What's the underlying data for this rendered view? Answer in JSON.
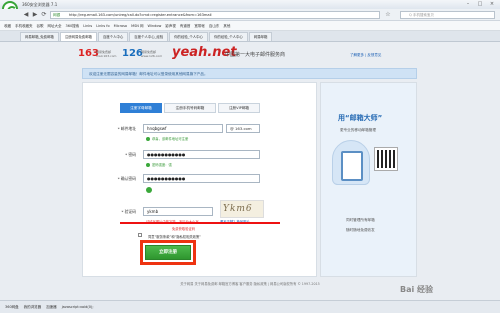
{
  "window": {
    "title": "360安全浏览器 7.1"
  },
  "addressbar": {
    "url": "http://reg.email.163.com/unireg/call.do?cmd=register.entrance&from=163mail",
    "security_tag": "网银",
    "search_placeholder": "Q 手机搜索宝贝"
  },
  "bookmarks": [
    "收藏",
    "手机收藏夹",
    "谷歌",
    "网址大全",
    "360搜索",
    "Links",
    "Links fo",
    "Microso",
    "MSN 网",
    "Window",
    "影声视",
    "有道首",
    "宽带帐",
    "百山东",
    "其他"
  ],
  "tabs": [
    {
      "label": "网易邮箱_免费邮箱",
      "active": false
    },
    {
      "label": "注册网易免费邮箱",
      "active": true
    },
    {
      "label": "百度个人中心",
      "active": false
    },
    {
      "label": "百度个人中心_经验",
      "active": false
    },
    {
      "label": "你的经验_个人中心",
      "active": false
    },
    {
      "label": "你的经验_个人中心",
      "active": false
    },
    {
      "label": "网易邮箱",
      "active": false
    }
  ],
  "header": {
    "brand_163": "163",
    "brand_163_sub": "网易免费邮 mail.163.com",
    "brand_126": "126",
    "brand_126_sub": "网易免费邮 www.126.com",
    "brand_yeah": "yeah.net",
    "slogan": "中国第一大电子邮件服务商",
    "links": "了解更多 | 反馈意见"
  },
  "notice": "欢迎注册无限容量的网易邮箱！邮件地址可以登录使用其他网易旗下产品。",
  "reg_tabs": [
    {
      "label": "注册字母邮箱",
      "active": true
    },
    {
      "label": "注册手机号码邮箱",
      "active": false
    },
    {
      "label": "注册VIP邮箱",
      "active": false
    }
  ],
  "form": {
    "email_label": "* 邮件地址",
    "email_value": "hnqbgswf",
    "domain": "@ 163.com",
    "email_hint": "恭喜，该邮件地址可注册",
    "password_label": "* 密码",
    "password_value": "●●●●●●●●●●●",
    "password_hint": "密码强度：强",
    "confirm_label": "* 确认密码",
    "confirm_value": "●●●●●●●●●●●",
    "captcha_label": "* 验证码",
    "captcha_value": "ykmb",
    "captcha_image_text": "Ykm6",
    "captcha_hint": "请填写图片中的字符，不区分大小写",
    "captcha_refresh": "看不清楚？换张图片",
    "captcha_error": "免费获取验证码",
    "agree_text": "同意“服务条款”和“隐私权相关政策”",
    "submit_label": "立即注册"
  },
  "promo": {
    "title": "用“邮箱大师”",
    "subtitle": "更专业的移动邮箱管理",
    "feature1": "同时管理所有邮箱",
    "feature2": "随时随地免费收发"
  },
  "footer": "关于网易  关于网易免费邮  邮箱官方博客  客户服务  隐私政策  |  网易公司版权所有 © 1997-2015",
  "statusbar": [
    "360网盘",
    "我的浏览器",
    "加速器",
    "javascript:void(0);"
  ],
  "watermark": "Bai 经验"
}
